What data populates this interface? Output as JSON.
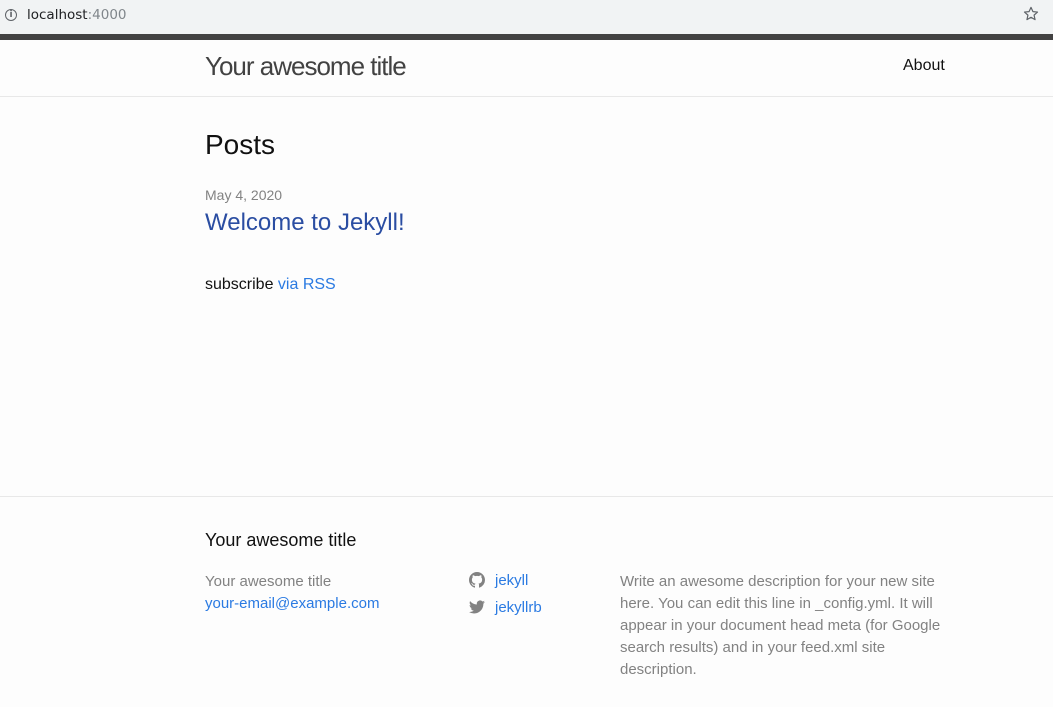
{
  "browser": {
    "url_host": "localhost",
    "url_port": ":4000"
  },
  "header": {
    "site_title": "Your awesome title",
    "nav_about": "About"
  },
  "main": {
    "heading": "Posts",
    "posts": [
      {
        "date": "May 4, 2020",
        "title": "Welcome to Jekyll!"
      }
    ],
    "subscribe_text": "subscribe ",
    "rss_link": "via RSS"
  },
  "footer": {
    "heading": "Your awesome title",
    "name": "Your awesome title",
    "email": "your-email@example.com",
    "social": [
      {
        "icon": "github-icon",
        "label": "jekyll"
      },
      {
        "icon": "twitter-icon",
        "label": "jekyllrb"
      }
    ],
    "description": "Write an awesome description for your new site here. You can edit this line in _config.yml. It will appear in your document head meta (for Google search results) and in your feed.xml site description."
  },
  "colors": {
    "link": "#2a7ae2",
    "post_link": "#2a4da2",
    "meta_grey": "#828282"
  }
}
